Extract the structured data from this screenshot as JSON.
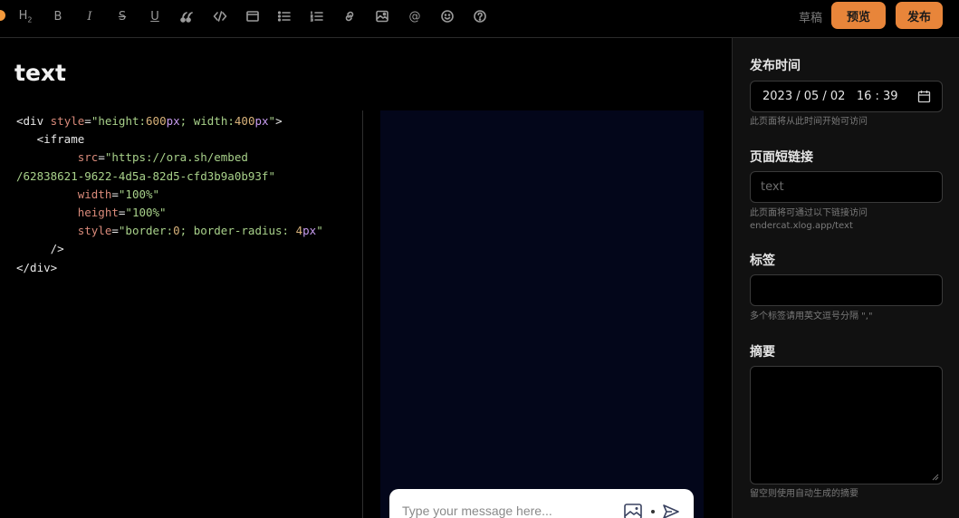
{
  "toolbar": {
    "tools": [
      {
        "name": "heading-icon",
        "glyph": "H₂"
      },
      {
        "name": "bold-icon",
        "glyph": "B"
      },
      {
        "name": "italic-icon",
        "glyph": "I"
      },
      {
        "name": "strikethrough-icon",
        "glyph": "S"
      },
      {
        "name": "underline-icon",
        "glyph": "U"
      },
      {
        "name": "quote-icon",
        "glyph": "❝"
      },
      {
        "name": "code-icon",
        "glyph": "</>"
      },
      {
        "name": "embed-icon",
        "glyph": "▭"
      },
      {
        "name": "bullet-list-icon",
        "glyph": "☰"
      },
      {
        "name": "ordered-list-icon",
        "glyph": "☷"
      },
      {
        "name": "link-icon",
        "glyph": "🔗"
      },
      {
        "name": "image-icon",
        "glyph": "▣"
      },
      {
        "name": "mention-icon",
        "glyph": "@"
      },
      {
        "name": "emoji-icon",
        "glyph": "☺"
      },
      {
        "name": "help-icon",
        "glyph": "?"
      }
    ],
    "draft_label": "草稿",
    "preview_label": "预览",
    "publish_label": "发布"
  },
  "editor": {
    "title": "text"
  },
  "chat": {
    "placeholder": "Type your message here..."
  },
  "sidebar": {
    "publish_time": {
      "label": "发布时间",
      "value": "2023 / 05 / 02   16 : 39",
      "help": "此页面将从此时间开始可访问"
    },
    "slug": {
      "label": "页面短链接",
      "placeholder": "text",
      "help_line1": "此页面将可通过以下链接访问",
      "help_line2": "endercat.xlog.app/text"
    },
    "tags": {
      "label": "标签",
      "help": "多个标签请用英文逗号分隔 \",\""
    },
    "summary": {
      "label": "摘要",
      "help": "留空则使用自动生成的摘要"
    }
  },
  "colors": {
    "accent": "#e8853a",
    "preview_bg": "#03061a",
    "sidebar_bg": "#111111"
  }
}
